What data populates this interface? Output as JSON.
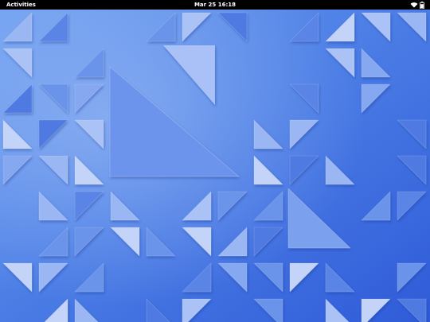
{
  "top_bar": {
    "activities_label": "Activities",
    "clock": "Mar 25 16:18",
    "status_icons": [
      "wifi-icon",
      "battery-icon"
    ]
  },
  "desktop": {
    "wallpaper": "blue-triangles-wallpaper"
  },
  "colors": {
    "top_bar": "#000000",
    "top_bar_text": "#ffffff",
    "wallpaper_base": "#4a7be6",
    "wallpaper_light": "#a8c0f5",
    "wallpaper_dark": "#2f5ad6"
  }
}
